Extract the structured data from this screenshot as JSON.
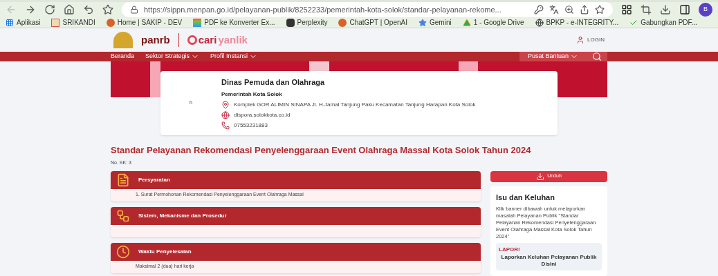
{
  "browser": {
    "url": "https://sippn.menpan.go.id/pelayanan-publik/8252233/pemerintah-kota-solok/standar-pelayanan-rekome...",
    "profile_initial": "B",
    "bookmarks": [
      {
        "label": "Aplikasi",
        "kind": "grid"
      },
      {
        "label": "SRIKANDI",
        "kind": "doc"
      },
      {
        "label": "Home | SAKIP - DEV",
        "kind": "circle"
      },
      {
        "label": "PDF ke Konverter Ex...",
        "kind": "rainbow"
      },
      {
        "label": "Perplexity",
        "kind": "dark"
      },
      {
        "label": "ChatGPT | OpenAI",
        "kind": "circle"
      },
      {
        "label": "Gemini",
        "kind": "star"
      },
      {
        "label": "1 - Google Drive",
        "kind": "drive"
      },
      {
        "label": "BPKP - e-INTEGRITY...",
        "kind": "globe"
      },
      {
        "label": "Gabungkan PDF...",
        "kind": "check"
      }
    ]
  },
  "site": {
    "logo": "panrb",
    "brand_a": "cari",
    "brand_b": "yanlik",
    "login": "LOGIN",
    "nav": [
      {
        "label": "Beranda",
        "dropdown": false
      },
      {
        "label": "Sektor Strategis",
        "dropdown": true
      },
      {
        "label": "Profil Instansi",
        "dropdown": true
      }
    ],
    "help": {
      "label": "Pusat Bantuan",
      "dropdown": true
    }
  },
  "agency": {
    "avatar_text": "h",
    "name": "Dinas Pemuda dan Olahraga",
    "parent": "Pemerintah Kota Solok",
    "address": "Komplek GOR ALIMIN SINAPA Jl. H.Jamal Tanjung Paku Kecamatan Tanjung Harapan Kota Solok",
    "website": "dispora.solokkota.co.id",
    "phone": "07553231883"
  },
  "page": {
    "title": "Standar Pelayanan Rekomendasi Penyelenggaraan Event Olahraga Massal Kota Solok Tahun 2024",
    "sk": "No. SK: 3"
  },
  "sections": [
    {
      "title": "Persyaratan",
      "kind": "doc",
      "body": "1. Surat Permohonan Rekomendasi Penyelenggaraan Event Olahraga Massal"
    },
    {
      "title": "Sistem, Mekanisme dan Prosedur",
      "kind": "flow"
    },
    {
      "title": "Waktu Penyelesaian",
      "kind": "clock",
      "body": "Maksimal 2 (dua) hari kerja"
    }
  ],
  "download": "Unduh",
  "issues": {
    "title": "Isu dan Keluhan",
    "text": "Klik banner dibawah untuk melaporkan masalah Pelayanan Publik \"Standar Pelayanan Rekomendasi Penyelenggaraan Event Olahraga Massal Kota Solok Tahun 2024\"",
    "banner_logo": "LAPOR!",
    "banner_text": "Laporkan Keluhan Pelayanan Publik Disini"
  }
}
